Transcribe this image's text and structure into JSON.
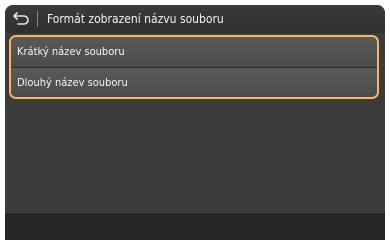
{
  "header": {
    "title": "Formát zobrazení názvu souboru",
    "back_icon": "back-arrow-icon"
  },
  "options": [
    {
      "label": "Krátký název souboru"
    },
    {
      "label": "Dlouhý název souboru"
    }
  ],
  "colors": {
    "panel_background": "#3b3b3b",
    "highlight_border": "#f2b866",
    "item_background": "#555555",
    "text": "#f5f5f5"
  }
}
